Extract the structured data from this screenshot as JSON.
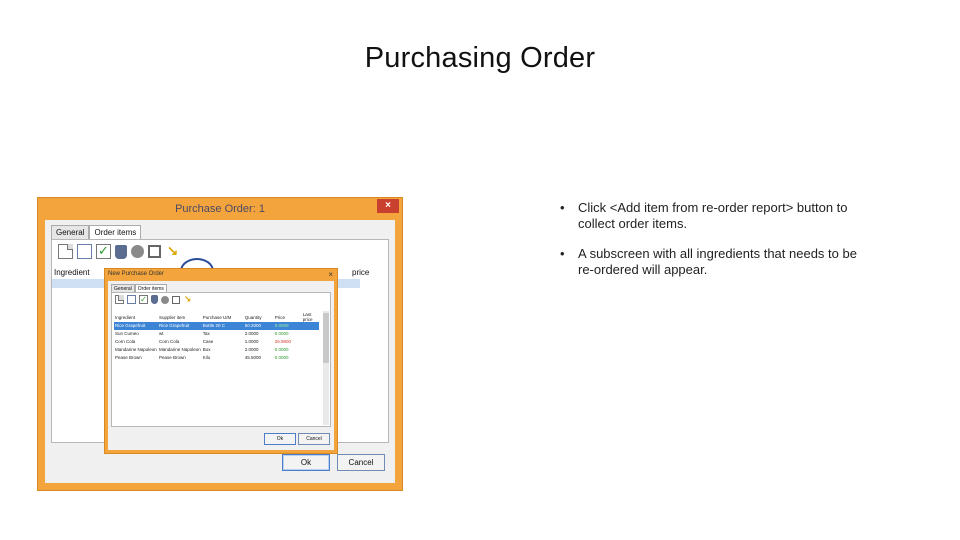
{
  "slide": {
    "title": "Purchasing Order",
    "bullets": [
      "Click <Add item from re-order report> button to collect order items.",
      "A subscreen with all ingredients that needs to be re-ordered will appear."
    ]
  },
  "outer_window": {
    "title": "Purchase Order: 1",
    "close": "×",
    "tabs": [
      "General",
      "Order items"
    ],
    "columns": [
      "Ingredient",
      "price"
    ],
    "ok_label": "Ok",
    "cancel_label": "Cancel"
  },
  "inner_window": {
    "title": "New Purchase Order",
    "close": "×",
    "tabs": [
      "General",
      "Order items"
    ],
    "columns": [
      "Ingredient",
      "Supplier item",
      "Purchase U/M",
      "Quantity",
      "Price",
      "Last price"
    ],
    "rows": [
      [
        "Rice Grapefruit",
        "Rice Grapefruit",
        "Bottle 20 C",
        "50.2000",
        "0.0000",
        ""
      ],
      [
        "Sun Cumeo",
        "wt",
        "Tax",
        "2.0000",
        "0.0000",
        ""
      ],
      [
        "Corn Cola",
        "Corn Cola",
        "Case",
        "1.0000",
        "26.9800",
        ""
      ],
      [
        "Mandarine Napoleon",
        "Mandarine Napoleon",
        "Box",
        "2.0000",
        "0.0000",
        ""
      ],
      [
        "Pease Brown",
        "Pease Brown",
        "Kilo",
        "45.5000",
        "0.0000",
        ""
      ]
    ],
    "ok_label": "Ok",
    "cancel_label": "Cancel"
  },
  "icons": [
    "new-doc-icon",
    "edit-doc-icon",
    "check-icon",
    "trash-icon",
    "gear-icon",
    "box-icon",
    "add-from-reorder-icon"
  ],
  "colors": {
    "window_frame": "#f4a43c",
    "selection": "#3b84d6",
    "highlight_circle": "#2a4d9a"
  }
}
